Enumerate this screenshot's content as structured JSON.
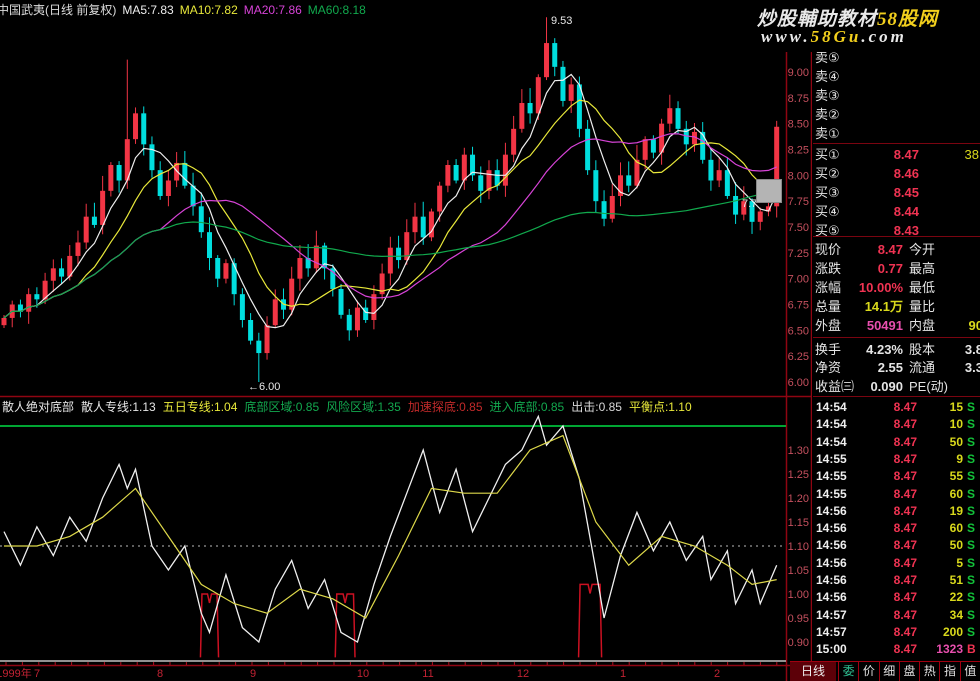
{
  "watermark": {
    "line1": [
      {
        "t": "炒股輔助教材",
        "c": "#e9e9e9"
      },
      {
        "t": "58股网",
        "c": "#f2cf1d"
      }
    ],
    "line2": [
      {
        "t": "www.",
        "c": "#e9e9e9"
      },
      {
        "t": "58Gu",
        "c": "#f2cf1d"
      },
      {
        "t": ".com",
        "c": "#e9e9e9"
      }
    ]
  },
  "quote": {
    "sell_rows": [
      {
        "label": "卖⑤",
        "price": "",
        "vol": ""
      },
      {
        "label": "卖④",
        "price": "",
        "vol": ""
      },
      {
        "label": "卖③",
        "price": "",
        "vol": ""
      },
      {
        "label": "卖②",
        "price": "",
        "vol": ""
      },
      {
        "label": "卖①",
        "price": "",
        "vol": ""
      }
    ],
    "buy_rows": [
      {
        "label": "买①",
        "price": "8.47",
        "vol": "38"
      },
      {
        "label": "买②",
        "price": "8.46",
        "vol": ""
      },
      {
        "label": "买③",
        "price": "8.45",
        "vol": ""
      },
      {
        "label": "买④",
        "price": "8.44",
        "vol": ""
      },
      {
        "label": "买⑤",
        "price": "8.43",
        "vol": ""
      }
    ],
    "stats": [
      {
        "label": "现价",
        "value": "8.47",
        "vc": "red",
        "label2": "今开",
        "value2": "",
        "vc2": "white"
      },
      {
        "label": "涨跌",
        "value": "0.77",
        "vc": "red",
        "label2": "最高",
        "value2": "",
        "vc2": "white"
      },
      {
        "label": "涨幅",
        "value": "10.00%",
        "vc": "red",
        "label2": "最低",
        "value2": "",
        "vc2": "white"
      },
      {
        "label": "总量",
        "value": "14.1万",
        "vc": "yellow",
        "label2": "量比",
        "value2": "",
        "vc2": "white"
      },
      {
        "label": "外盘",
        "value": "50491",
        "vc": "magenta",
        "label2": "内盘",
        "value2": "90",
        "vc2": "yellow"
      }
    ],
    "stats2": [
      {
        "label": "换手",
        "value": "4.23%",
        "vc": "white",
        "label2": "股本",
        "value2": "3.8",
        "vc2": "white"
      },
      {
        "label": "净资",
        "value": "2.55",
        "vc": "white",
        "label2": "流通",
        "value2": "3.3",
        "vc2": "white"
      },
      {
        "label": "收益㈢",
        "value": "0.090",
        "vc": "white",
        "label2": "PE(动)",
        "value2": "",
        "vc2": "white"
      }
    ],
    "ticks": [
      {
        "time": "14:54",
        "price": "8.47",
        "vol": "15",
        "side": "S",
        "vc": "yellow"
      },
      {
        "time": "14:54",
        "price": "8.47",
        "vol": "10",
        "side": "S",
        "vc": "yellow"
      },
      {
        "time": "14:54",
        "price": "8.47",
        "vol": "50",
        "side": "S",
        "vc": "yellow"
      },
      {
        "time": "14:55",
        "price": "8.47",
        "vol": "9",
        "side": "S",
        "vc": "yellow"
      },
      {
        "time": "14:55",
        "price": "8.47",
        "vol": "55",
        "side": "S",
        "vc": "yellow"
      },
      {
        "time": "14:55",
        "price": "8.47",
        "vol": "60",
        "side": "S",
        "vc": "yellow"
      },
      {
        "time": "14:56",
        "price": "8.47",
        "vol": "19",
        "side": "S",
        "vc": "yellow"
      },
      {
        "time": "14:56",
        "price": "8.47",
        "vol": "60",
        "side": "S",
        "vc": "yellow"
      },
      {
        "time": "14:56",
        "price": "8.47",
        "vol": "50",
        "side": "S",
        "vc": "yellow"
      },
      {
        "time": "14:56",
        "price": "8.47",
        "vol": "5",
        "side": "S",
        "vc": "yellow"
      },
      {
        "time": "14:56",
        "price": "8.47",
        "vol": "51",
        "side": "S",
        "vc": "yellow"
      },
      {
        "time": "14:56",
        "price": "8.47",
        "vol": "22",
        "side": "S",
        "vc": "yellow"
      },
      {
        "time": "14:57",
        "price": "8.47",
        "vol": "34",
        "side": "S",
        "vc": "yellow"
      },
      {
        "time": "14:57",
        "price": "8.47",
        "vol": "200",
        "side": "S",
        "vc": "yellow"
      },
      {
        "time": "15:00",
        "price": "8.47",
        "vol": "1323",
        "side": "B",
        "vc": "magenta"
      }
    ]
  },
  "bottom": {
    "period_label": "日线",
    "tabs": [
      "委",
      "价",
      "细",
      "盘",
      "热",
      "指",
      "值"
    ]
  },
  "colors": {
    "up": "#f23545",
    "down": "#00dede",
    "frame": "#8f0512",
    "axis_text": "#c4505e",
    "white_line": "#f0f0f0",
    "yellow_line": "#ddd84a",
    "signal": "#cc1122",
    "balance_dotted": "#bbbbbb",
    "risk_green": "#00dd44"
  },
  "chart_data": [
    {
      "type": "candlestick",
      "title": "中国武夷(日线 前复权)",
      "ma_labels": [
        {
          "t": "MA5:7.83",
          "c": "#eeeeee"
        },
        {
          "t": "MA10:7.82",
          "c": "#e8e83a"
        },
        {
          "t": "MA20:7.86",
          "c": "#d743d7"
        },
        {
          "t": "MA60:8.18",
          "c": "#11a94d"
        }
      ],
      "ma_periods": [
        5,
        10,
        20,
        60
      ],
      "ma_colors": [
        "#eeeeee",
        "#e8e83a",
        "#d743d7",
        "#11a94d"
      ],
      "ylim": [
        5.9,
        9.56
      ],
      "yticks": [
        "9.00",
        "8.75",
        "8.50",
        "8.25",
        "8.00",
        "7.75",
        "7.50",
        "7.25",
        "7.00",
        "6.75",
        "6.50",
        "6.25",
        "6.00"
      ],
      "xticks": [
        {
          "t": "1999年",
          "x": 14
        },
        {
          "t": "7",
          "x": 37
        },
        {
          "t": "8",
          "x": 160
        },
        {
          "t": "9",
          "x": 253
        },
        {
          "t": "10",
          "x": 363
        },
        {
          "t": "11",
          "x": 428
        },
        {
          "t": "12",
          "x": 523
        },
        {
          "t": "1",
          "x": 623
        },
        {
          "t": "2",
          "x": 717
        }
      ],
      "first_open": 6.55,
      "wick": 0.07,
      "closes": [
        6.62,
        6.75,
        6.68,
        6.85,
        6.8,
        6.98,
        7.1,
        7.02,
        7.22,
        7.35,
        7.6,
        7.52,
        7.85,
        8.1,
        7.95,
        8.35,
        8.6,
        8.3,
        8.05,
        7.8,
        7.95,
        8.12,
        7.9,
        7.7,
        7.45,
        7.2,
        7.0,
        7.15,
        6.85,
        6.6,
        6.4,
        6.28,
        6.55,
        6.8,
        6.7,
        7.0,
        7.2,
        7.1,
        7.32,
        7.1,
        6.9,
        6.65,
        6.5,
        6.72,
        6.6,
        6.85,
        7.05,
        7.3,
        7.18,
        7.45,
        7.6,
        7.4,
        7.65,
        7.9,
        8.1,
        7.95,
        8.2,
        8.0,
        7.85,
        8.05,
        7.9,
        8.2,
        8.45,
        8.7,
        8.6,
        8.95,
        9.28,
        9.05,
        8.72,
        8.88,
        8.45,
        8.05,
        7.75,
        7.58,
        7.8,
        8.0,
        7.9,
        8.15,
        8.35,
        8.22,
        8.5,
        8.65,
        8.45,
        8.3,
        8.42,
        8.15,
        7.95,
        8.05,
        7.8,
        7.62,
        7.75,
        7.55,
        7.65,
        7.7,
        8.47
      ],
      "overrides": {
        "15": {
          "h": 9.12
        },
        "31": {
          "l": 6.0
        },
        "66": {
          "h": 9.53
        },
        "81": {
          "h": 8.78
        }
      },
      "annotations": [
        {
          "text": "9.53",
          "x": 551,
          "y": 24
        },
        {
          "text": "←6.00",
          "x": 248,
          "y": 390
        },
        {
          "text": "7.7",
          "x": 742,
          "y": 207
        }
      ]
    },
    {
      "type": "line",
      "title": "散人绝对底部",
      "header": [
        {
          "t": "散人专线:1.13",
          "c": "#e6e6e6"
        },
        {
          "t": "五日专线:1.04",
          "c": "#e8e83a"
        },
        {
          "t": "底部区域:0.85",
          "c": "#13a94f"
        },
        {
          "t": "风险区域:1.35",
          "c": "#13a94f"
        },
        {
          "t": "加速探底:0.85",
          "c": "#c22a2a"
        },
        {
          "t": "进入底部:0.85",
          "c": "#13a94f"
        },
        {
          "t": "出击:0.85",
          "c": "#d8d8d8"
        },
        {
          "t": "平衡点:1.10",
          "c": "#e8e83a"
        }
      ],
      "ylim": [
        0.865,
        1.375
      ],
      "yticks": [
        "1.30",
        "1.25",
        "1.20",
        "1.15",
        "1.10",
        "1.05",
        "1.00",
        "0.95",
        "0.90"
      ],
      "hlines": [
        {
          "v": 1.35,
          "c": "#00dd44",
          "dash": "",
          "label": "风险区域"
        },
        {
          "v": 1.1,
          "c": "#bbbbbb",
          "dash": "2,4",
          "label": "平衡点"
        }
      ],
      "series": [
        {
          "name": "散人专线",
          "color": "#f0f0f0",
          "points": [
            [
              0,
              1.13
            ],
            [
              2,
              1.06
            ],
            [
              4,
              1.14
            ],
            [
              6,
              1.08
            ],
            [
              8,
              1.16
            ],
            [
              10,
              1.11
            ],
            [
              12,
              1.2
            ],
            [
              14,
              1.27
            ],
            [
              15,
              1.22
            ],
            [
              16,
              1.26
            ],
            [
              18,
              1.1
            ],
            [
              20,
              1.05
            ],
            [
              22,
              1.1
            ],
            [
              24,
              0.96
            ],
            [
              25,
              0.92
            ],
            [
              27,
              1.04
            ],
            [
              29,
              0.93
            ],
            [
              31,
              0.9
            ],
            [
              33,
              1.01
            ],
            [
              35,
              1.07
            ],
            [
              37,
              0.97
            ],
            [
              39,
              1.03
            ],
            [
              41,
              0.92
            ],
            [
              43,
              0.9
            ],
            [
              45,
              1.02
            ],
            [
              47,
              1.12
            ],
            [
              49,
              1.21
            ],
            [
              51,
              1.3
            ],
            [
              53,
              1.17
            ],
            [
              55,
              1.26
            ],
            [
              57,
              1.13
            ],
            [
              59,
              1.2
            ],
            [
              61,
              1.27
            ],
            [
              63,
              1.3
            ],
            [
              65,
              1.37
            ],
            [
              66,
              1.31
            ],
            [
              68,
              1.35
            ],
            [
              70,
              1.24
            ],
            [
              72,
              1.05
            ],
            [
              73,
              0.95
            ],
            [
              75,
              1.08
            ],
            [
              77,
              1.17
            ],
            [
              79,
              1.09
            ],
            [
              81,
              1.15
            ],
            [
              83,
              1.07
            ],
            [
              85,
              1.12
            ],
            [
              86,
              1.03
            ],
            [
              88,
              1.09
            ],
            [
              89,
              0.98
            ],
            [
              91,
              1.05
            ],
            [
              92,
              0.98
            ],
            [
              94,
              1.06
            ]
          ]
        },
        {
          "name": "五日专线",
          "color": "#ddd84a",
          "points": [
            [
              0,
              1.1
            ],
            [
              4,
              1.1
            ],
            [
              8,
              1.12
            ],
            [
              12,
              1.16
            ],
            [
              16,
              1.22
            ],
            [
              20,
              1.12
            ],
            [
              24,
              1.02
            ],
            [
              28,
              0.98
            ],
            [
              32,
              0.96
            ],
            [
              36,
              1.01
            ],
            [
              40,
              0.99
            ],
            [
              44,
              0.95
            ],
            [
              48,
              1.08
            ],
            [
              52,
              1.22
            ],
            [
              56,
              1.21
            ],
            [
              60,
              1.21
            ],
            [
              64,
              1.3
            ],
            [
              68,
              1.33
            ],
            [
              72,
              1.15
            ],
            [
              76,
              1.06
            ],
            [
              80,
              1.12
            ],
            [
              84,
              1.1
            ],
            [
              88,
              1.06
            ],
            [
              91,
              1.02
            ],
            [
              94,
              1.03
            ]
          ]
        }
      ],
      "signals": {
        "name": "进入底部",
        "color": "#cc1122",
        "base": 0.868,
        "towers": [
          {
            "x": 25,
            "w": 2.2,
            "top": 1.0
          },
          {
            "x": 41.5,
            "w": 2.4,
            "top": 1.0
          },
          {
            "x": 71.3,
            "w": 2.8,
            "top": 1.02
          }
        ]
      }
    }
  ]
}
